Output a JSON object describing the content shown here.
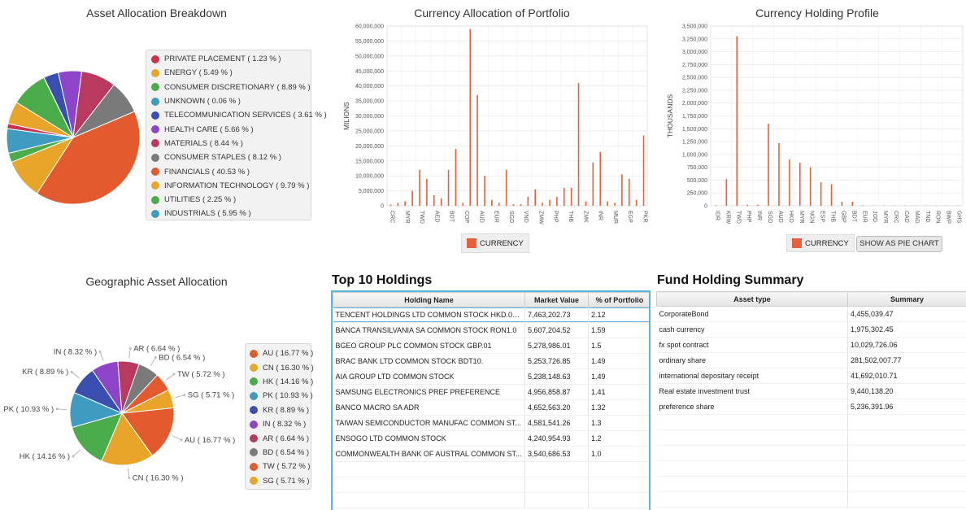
{
  "asset_allocation": {
    "title": "Asset Allocation Breakdown",
    "legend": [
      {
        "label": "PRIVATE PLACEMENT ( 1.23 % )",
        "color": "#c9324a"
      },
      {
        "label": "ENERGY ( 5.49 % )",
        "color": "#e8a52a"
      },
      {
        "label": "CONSUMER DISCRETIONARY ( 8.89 % )",
        "color": "#4aac4a"
      },
      {
        "label": "UNKNOWN ( 0.06 % )",
        "color": "#3f9cc0"
      },
      {
        "label": "TELECOMMUNICATION SERVICES ( 3.61 % )",
        "color": "#3a4fb0"
      },
      {
        "label": "HEALTH CARE ( 5.66 % )",
        "color": "#8e44c8"
      },
      {
        "label": "MATERIALS ( 8.44 % )",
        "color": "#b83a5e"
      },
      {
        "label": "CONSUMER STAPLES ( 8.12 % )",
        "color": "#7a7a7a"
      },
      {
        "label": "FINANCIALS ( 40.53 % )",
        "color": "#e35a2e"
      },
      {
        "label": "INFORMATION TECHNOLOGY ( 9.79 % )",
        "color": "#e8a52a"
      },
      {
        "label": "UTILITIES ( 2.25 % )",
        "color": "#4aac4a"
      },
      {
        "label": "INDUSTRIALS ( 5.95 % )",
        "color": "#3f9cc0"
      }
    ]
  },
  "currency_allocation": {
    "title": "Currency Allocation of Portfolio",
    "legend_label": "CURRENCY",
    "bar_color": "#e8603a"
  },
  "currency_holding": {
    "title": "Currency Holding Profile",
    "legend_label": "CURRENCY",
    "show_pie_label": "SHOW AS PIE CHART"
  },
  "chart_data": [
    {
      "type": "pie",
      "title": "Asset Allocation Breakdown",
      "slices": [
        {
          "name": "FINANCIALS",
          "value": 40.53,
          "color": "#e35a2e"
        },
        {
          "name": "INFORMATION TECHNOLOGY",
          "value": 9.79,
          "color": "#e8a52a"
        },
        {
          "name": "UTILITIES",
          "value": 2.25,
          "color": "#4aac4a"
        },
        {
          "name": "INDUSTRIALS",
          "value": 5.95,
          "color": "#3f9cc0"
        },
        {
          "name": "PRIVATE PLACEMENT",
          "value": 1.23,
          "color": "#c9324a"
        },
        {
          "name": "ENERGY",
          "value": 5.49,
          "color": "#e8a52a"
        },
        {
          "name": "CONSUMER DISCRETIONARY",
          "value": 8.89,
          "color": "#4aac4a"
        },
        {
          "name": "UNKNOWN",
          "value": 0.06,
          "color": "#3f9cc0"
        },
        {
          "name": "TELECOMMUNICATION SERVICES",
          "value": 3.61,
          "color": "#3a4fb0"
        },
        {
          "name": "HEALTH CARE",
          "value": 5.66,
          "color": "#8e44c8"
        },
        {
          "name": "MATERIALS",
          "value": 8.44,
          "color": "#b83a5e"
        },
        {
          "name": "CONSUMER STAPLES",
          "value": 8.12,
          "color": "#7a7a7a"
        }
      ]
    },
    {
      "type": "bar",
      "title": "Currency Allocation of Portfolio",
      "ylabel": "MILIONS",
      "ylim": [
        0,
        60000000
      ],
      "yticks": [
        "0",
        "5,000,000",
        "10,000,000",
        "15,000,000",
        "20,000,000",
        "25,000,000",
        "30,000,000",
        "35,000,000",
        "40,000,000",
        "45,000,000",
        "50,000,000",
        "55,000,000",
        "60,000,000"
      ],
      "categories": [
        "CRC",
        "",
        "MYR",
        "",
        "TWD",
        "",
        "AED",
        "",
        "BDT",
        "",
        "COP",
        "",
        "AUD",
        "",
        "EUR",
        "",
        "SGD",
        "",
        "VND",
        "",
        "ZMW",
        "",
        "PHP",
        "",
        "THB",
        "",
        "ZMK",
        "",
        "INR",
        "",
        "MUR",
        "",
        "EGP",
        "",
        "PKR"
      ],
      "values": [
        400000,
        1000000,
        1500000,
        5000000,
        12000000,
        9000000,
        3500000,
        2500000,
        12000000,
        19000000,
        1000000,
        59000000,
        37000000,
        10000000,
        2000000,
        1000000,
        12000000,
        500000,
        500000,
        3000000,
        5500000,
        1000000,
        2000000,
        3000000,
        6000000,
        6000000,
        41000000,
        1500000,
        14500000,
        18000000,
        1500000,
        1000000,
        10500000,
        9000000,
        2000000,
        23500000
      ],
      "legend": [
        "CURRENCY"
      ]
    },
    {
      "type": "bar",
      "title": "Currency Holding Profile",
      "ylabel": "THOUSANDS",
      "ylim": [
        0,
        3500000
      ],
      "yticks": [
        "0",
        "250,000",
        "500,000",
        "750,000",
        "1,000,000",
        "1,250,000",
        "1,500,000",
        "1,750,000",
        "2,000,000",
        "2,250,000",
        "2,500,000",
        "2,750,000",
        "3,000,000",
        "3,250,000",
        "3,500,000"
      ],
      "categories": [
        "IDR",
        "KRW",
        "TWD",
        "PHP",
        "INR",
        "SGD",
        "AUD",
        "HKD",
        "MYR",
        "NGN",
        "ESP",
        "THB",
        "GBP",
        "BDT",
        "EUR",
        "JOD",
        "MYR",
        "CRC",
        "CAD",
        "MAD",
        "TND",
        "RON",
        "BWP",
        "GHS"
      ],
      "values": [
        10000,
        520000,
        3300000,
        20000,
        20000,
        1600000,
        1220000,
        900000,
        840000,
        750000,
        460000,
        420000,
        80000,
        80000,
        10000,
        5000,
        5000,
        5000,
        5000,
        5000,
        5000,
        5000,
        5000,
        5000
      ],
      "legend": [
        "CURRENCY"
      ]
    },
    {
      "type": "pie",
      "title": "Geographic Asset Allocation",
      "slices": [
        {
          "name": "AU",
          "label": "AU ( 16.77 % )",
          "value": 16.77,
          "color": "#e35a2e"
        },
        {
          "name": "CN",
          "label": "CN ( 16.30 % )",
          "value": 16.3,
          "color": "#e8a52a"
        },
        {
          "name": "HK",
          "label": "HK ( 14.16 % )",
          "value": 14.16,
          "color": "#4aac4a"
        },
        {
          "name": "PK",
          "label": "PK ( 10.93 % )",
          "value": 10.93,
          "color": "#3f9cc0"
        },
        {
          "name": "KR",
          "label": "KR ( 8.89 % )",
          "value": 8.89,
          "color": "#3a4fb0"
        },
        {
          "name": "IN",
          "label": "IN ( 8.32 % )",
          "value": 8.32,
          "color": "#8e44c8"
        },
        {
          "name": "AR",
          "label": "AR ( 6.64 % )",
          "value": 6.64,
          "color": "#b83a5e"
        },
        {
          "name": "BD",
          "label": "BD ( 6.54 % )",
          "value": 6.54,
          "color": "#7a7a7a"
        },
        {
          "name": "TW",
          "label": "TW ( 5.72 % )",
          "value": 5.72,
          "color": "#e35a2e"
        },
        {
          "name": "SG",
          "label": "SG ( 5.71 % )",
          "value": 5.71,
          "color": "#e8a52a"
        }
      ]
    }
  ],
  "geographic": {
    "title": "Geographic Asset Allocation",
    "legend": [
      {
        "label": "AU ( 16.77 % )",
        "color": "#e35a2e"
      },
      {
        "label": "CN ( 16.30 % )",
        "color": "#e8a52a"
      },
      {
        "label": "HK ( 14.16 % )",
        "color": "#4aac4a"
      },
      {
        "label": "PK ( 10.93 % )",
        "color": "#3f9cc0"
      },
      {
        "label": "KR ( 8.89 % )",
        "color": "#3a4fb0"
      },
      {
        "label": "IN ( 8.32 % )",
        "color": "#8e44c8"
      },
      {
        "label": "AR ( 6.64 % )",
        "color": "#b83a5e"
      },
      {
        "label": "BD ( 6.54 % )",
        "color": "#7a7a7a"
      },
      {
        "label": "TW ( 5.72 % )",
        "color": "#e35a2e"
      },
      {
        "label": "SG ( 5.71 % )",
        "color": "#e8a52a"
      }
    ]
  },
  "top_holdings": {
    "title": "Top 10 Holdings",
    "columns": [
      "Holding Name",
      "Market Value",
      "% of Portfolio"
    ],
    "rows": [
      [
        "TENCENT HOLDINGS LTD COMMON STOCK HKD.000...",
        "7,463,202.73",
        "2.12"
      ],
      [
        "BANCA TRANSILVANIA SA COMMON STOCK RON1.0",
        "5,607,204.52",
        "1.59"
      ],
      [
        "BGEO GROUP PLC COMMON STOCK GBP.01",
        "5,278,986.01",
        "1.5"
      ],
      [
        "BRAC BANK LTD COMMON STOCK BDT10.",
        "5,253,726.85",
        "1.49"
      ],
      [
        "AIA GROUP LTD COMMON STOCK",
        "5,238,148.63",
        "1.49"
      ],
      [
        "SAMSUNG ELECTRONICS PREF PREFERENCE",
        "4,956,858.87",
        "1.41"
      ],
      [
        "BANCO MACRO SA ADR",
        "4,652,563.20",
        "1.32"
      ],
      [
        "TAIWAN SEMICONDUCTOR MANUFAC COMMON ST...",
        "4,581,541.26",
        "1.3"
      ],
      [
        "ENSOGO LTD COMMON STOCK",
        "4,240,954.93",
        "1.2"
      ],
      [
        "COMMONWEALTH BANK OF AUSTRAL COMMON ST...",
        "3,540,686.53",
        "1.0"
      ]
    ]
  },
  "fund_summary": {
    "title": "Fund Holding Summary",
    "columns": [
      "Asset type",
      "Summary"
    ],
    "rows": [
      [
        "CorporateBond",
        "4,455,039.47"
      ],
      [
        "cash currency",
        "1,975,302.45"
      ],
      [
        "fx spot contract",
        "10,029,726.06"
      ],
      [
        "ordinary share",
        "281,502,007.77"
      ],
      [
        "international depositary receipt",
        "41,692,010.71"
      ],
      [
        "Real estate investment trust",
        "9,440,138.20"
      ],
      [
        "preference share",
        "5,236,391.96"
      ]
    ]
  }
}
